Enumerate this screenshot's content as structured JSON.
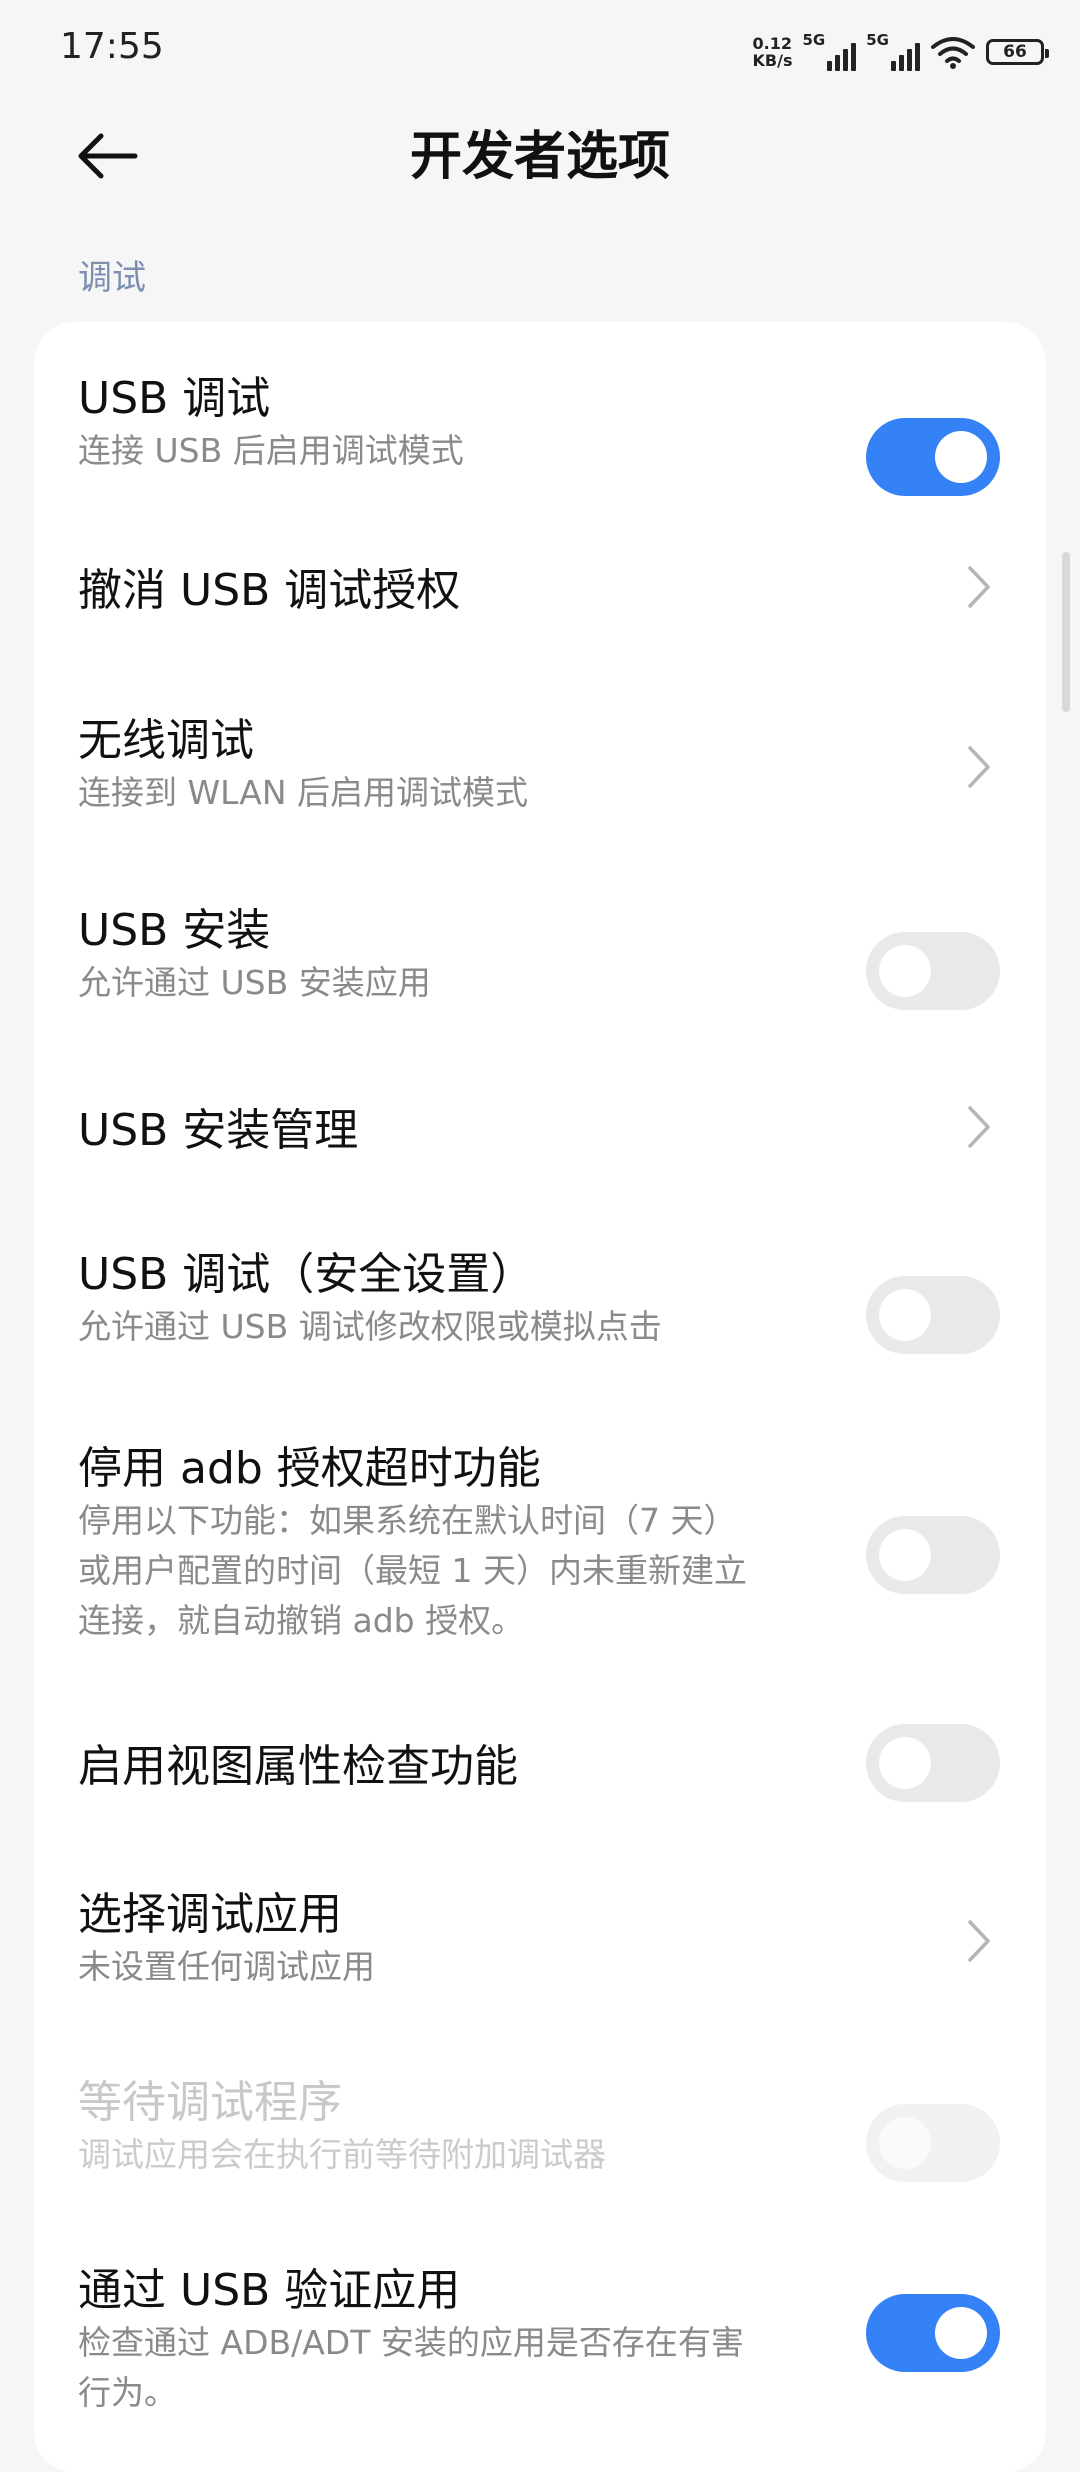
{
  "status_bar": {
    "time": "17:55",
    "net_speed_value": "0.12",
    "net_speed_unit": "KB/s",
    "sim1_label": "5G",
    "sim2_label": "5G",
    "battery_level": "66"
  },
  "header": {
    "title": "开发者选项"
  },
  "section": {
    "label": "调试"
  },
  "items": [
    {
      "title": "USB 调试",
      "subtitle": "连接 USB 后启用调试模式",
      "control": "switch",
      "state": "on"
    },
    {
      "title": "撤消 USB 调试授权",
      "control": "chevron"
    },
    {
      "title": "无线调试",
      "subtitle": "连接到 WLAN 后启用调试模式",
      "control": "chevron"
    },
    {
      "title": "USB 安装",
      "subtitle": "允许通过 USB 安装应用",
      "control": "switch",
      "state": "off"
    },
    {
      "title": "USB 安装管理",
      "control": "chevron"
    },
    {
      "title": "USB 调试（安全设置）",
      "subtitle": "允许通过 USB 调试修改权限或模拟点击",
      "control": "switch",
      "state": "off"
    },
    {
      "title": "停用 adb 授权超时功能",
      "subtitle_lines": [
        "停用以下功能：如果系统在默认时间（7 天）",
        "或用户配置的时间（最短 1 天）内未重新建立",
        "连接，就自动撤销 adb 授权。"
      ],
      "control": "switch",
      "state": "off"
    },
    {
      "title": "启用视图属性检查功能",
      "control": "switch",
      "state": "off"
    },
    {
      "title": "选择调试应用",
      "subtitle": "未设置任何调试应用",
      "control": "chevron"
    },
    {
      "title": "等待调试程序",
      "subtitle": "调试应用会在执行前等待附加调试器",
      "control": "switch",
      "state": "disabled"
    },
    {
      "title": "通过 USB 验证应用",
      "subtitle_lines": [
        "检查通过 ADB/ADT 安装的应用是否存在有害",
        "行为。"
      ],
      "control": "switch",
      "state": "on"
    }
  ],
  "colors": {
    "accent": "#3482f6",
    "section_label": "#7d8fb1",
    "background": "#f6f6f6"
  },
  "icons": {
    "back": "arrow-left-icon",
    "chevron": "chevron-right-icon",
    "wifi": "wifi-icon",
    "battery": "battery-icon",
    "signal": "cell-signal-icon"
  }
}
